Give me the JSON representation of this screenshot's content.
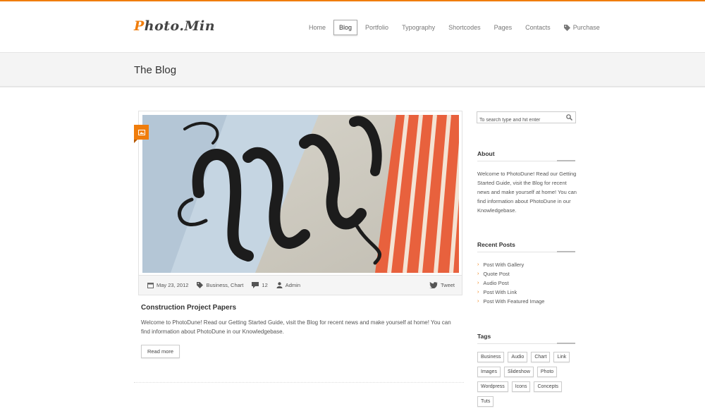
{
  "brand": {
    "logo_first": "P",
    "logo_rest": "hoto.Min",
    "accent_color": "#f07d0c"
  },
  "nav": {
    "items": [
      {
        "label": "Home",
        "active": false
      },
      {
        "label": "Blog",
        "active": true
      },
      {
        "label": "Portfolio",
        "active": false
      },
      {
        "label": "Typography",
        "active": false
      },
      {
        "label": "Shortcodes",
        "active": false
      },
      {
        "label": "Pages",
        "active": false
      },
      {
        "label": "Contacts",
        "active": false
      },
      {
        "label": "Purchase",
        "active": false,
        "icon": "tag-icon"
      }
    ]
  },
  "page": {
    "title": "The Blog"
  },
  "post": {
    "type_icon": "image-icon",
    "date": "May 23, 2012",
    "categories": "Business, Chart",
    "comments": "12",
    "author": "Admin",
    "tweet_label": "Tweet",
    "title": "Construction Project Papers",
    "excerpt": "Welcome to PhotoDune! Read our Getting Started Guide, visit the Blog for recent news and make yourself at home! You can find information about PhotoDune in our Knowledgebase.",
    "read_more": "Read more"
  },
  "sidebar": {
    "search_placeholder": "To search type and hit enter",
    "about": {
      "title": "About",
      "text": "Welcome to PhotoDune! Read our Getting Started Guide, visit the Blog for recent news and make yourself at home! You can find information about PhotoDune in our Knowledgebase."
    },
    "recent": {
      "title": "Recent Posts",
      "items": [
        "Post With Gallery",
        "Quote Post",
        "Audio Post",
        "Post With Link",
        "Post With Featured Image"
      ]
    },
    "tags": {
      "title": "Tags",
      "items": [
        "Business",
        "Audio",
        "Chart",
        "Link",
        "Images",
        "Slideshow",
        "Photo",
        "Wordpress",
        "Icons",
        "Concepts",
        "Tuts"
      ]
    }
  }
}
